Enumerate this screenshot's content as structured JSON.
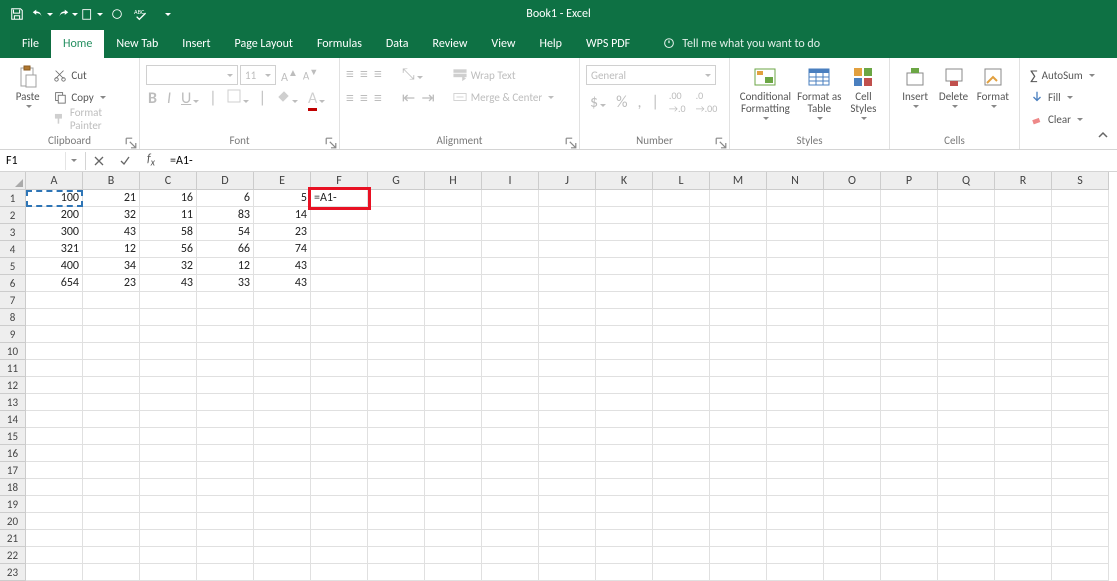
{
  "app_title": "Book1  -  Excel",
  "tabs": {
    "file": "File",
    "home": "Home",
    "newtab": "New Tab",
    "insert": "Insert",
    "pagelayout": "Page Layout",
    "formulas": "Formulas",
    "data": "Data",
    "review": "Review",
    "view": "View",
    "help": "Help",
    "wps": "WPS PDF",
    "tellme": "Tell me what you want to do"
  },
  "ribbon": {
    "clipboard": {
      "label": "Clipboard",
      "paste": "Paste",
      "cut": "Cut",
      "copy": "Copy",
      "painter": "Format Painter"
    },
    "font": {
      "label": "Font",
      "name": "",
      "size": "11",
      "bold": "B",
      "italic": "I",
      "underline": "U"
    },
    "alignment": {
      "label": "Alignment",
      "wrap": "Wrap Text",
      "merge": "Merge & Center"
    },
    "number": {
      "label": "Number",
      "format": "General"
    },
    "styles": {
      "label": "Styles",
      "cond": "Conditional Formatting",
      "table": "Format as Table",
      "cell": "Cell Styles"
    },
    "cells": {
      "label": "Cells",
      "insert": "Insert",
      "delete": "Delete",
      "format": "Format"
    },
    "editing": {
      "label": "",
      "autosum": "AutoSum",
      "fill": "Fill",
      "clear": "Clear"
    }
  },
  "namebox": "F1",
  "formula": "=A1-",
  "columns": [
    "A",
    "B",
    "C",
    "D",
    "E",
    "F",
    "G",
    "H",
    "I",
    "J",
    "K",
    "L",
    "M",
    "N",
    "O",
    "P",
    "Q",
    "R",
    "S"
  ],
  "rows": [
    "1",
    "2",
    "3",
    "4",
    "5",
    "6",
    "7",
    "8",
    "9",
    "10",
    "11",
    "12",
    "13",
    "14",
    "15",
    "16",
    "17",
    "18",
    "19",
    "20",
    "21",
    "22",
    "23"
  ],
  "cellData": {
    "r1": {
      "A": "100",
      "B": "21",
      "C": "16",
      "D": "6",
      "E": "5",
      "F": "=A1-"
    },
    "r2": {
      "A": "200",
      "B": "32",
      "C": "11",
      "D": "83",
      "E": "14"
    },
    "r3": {
      "A": "300",
      "B": "43",
      "C": "58",
      "D": "54",
      "E": "23"
    },
    "r4": {
      "A": "321",
      "B": "12",
      "C": "56",
      "D": "66",
      "E": "74"
    },
    "r5": {
      "A": "400",
      "B": "34",
      "C": "32",
      "D": "12",
      "E": "43"
    },
    "r6": {
      "A": "654",
      "B": "23",
      "C": "43",
      "D": "33",
      "E": "43"
    }
  }
}
